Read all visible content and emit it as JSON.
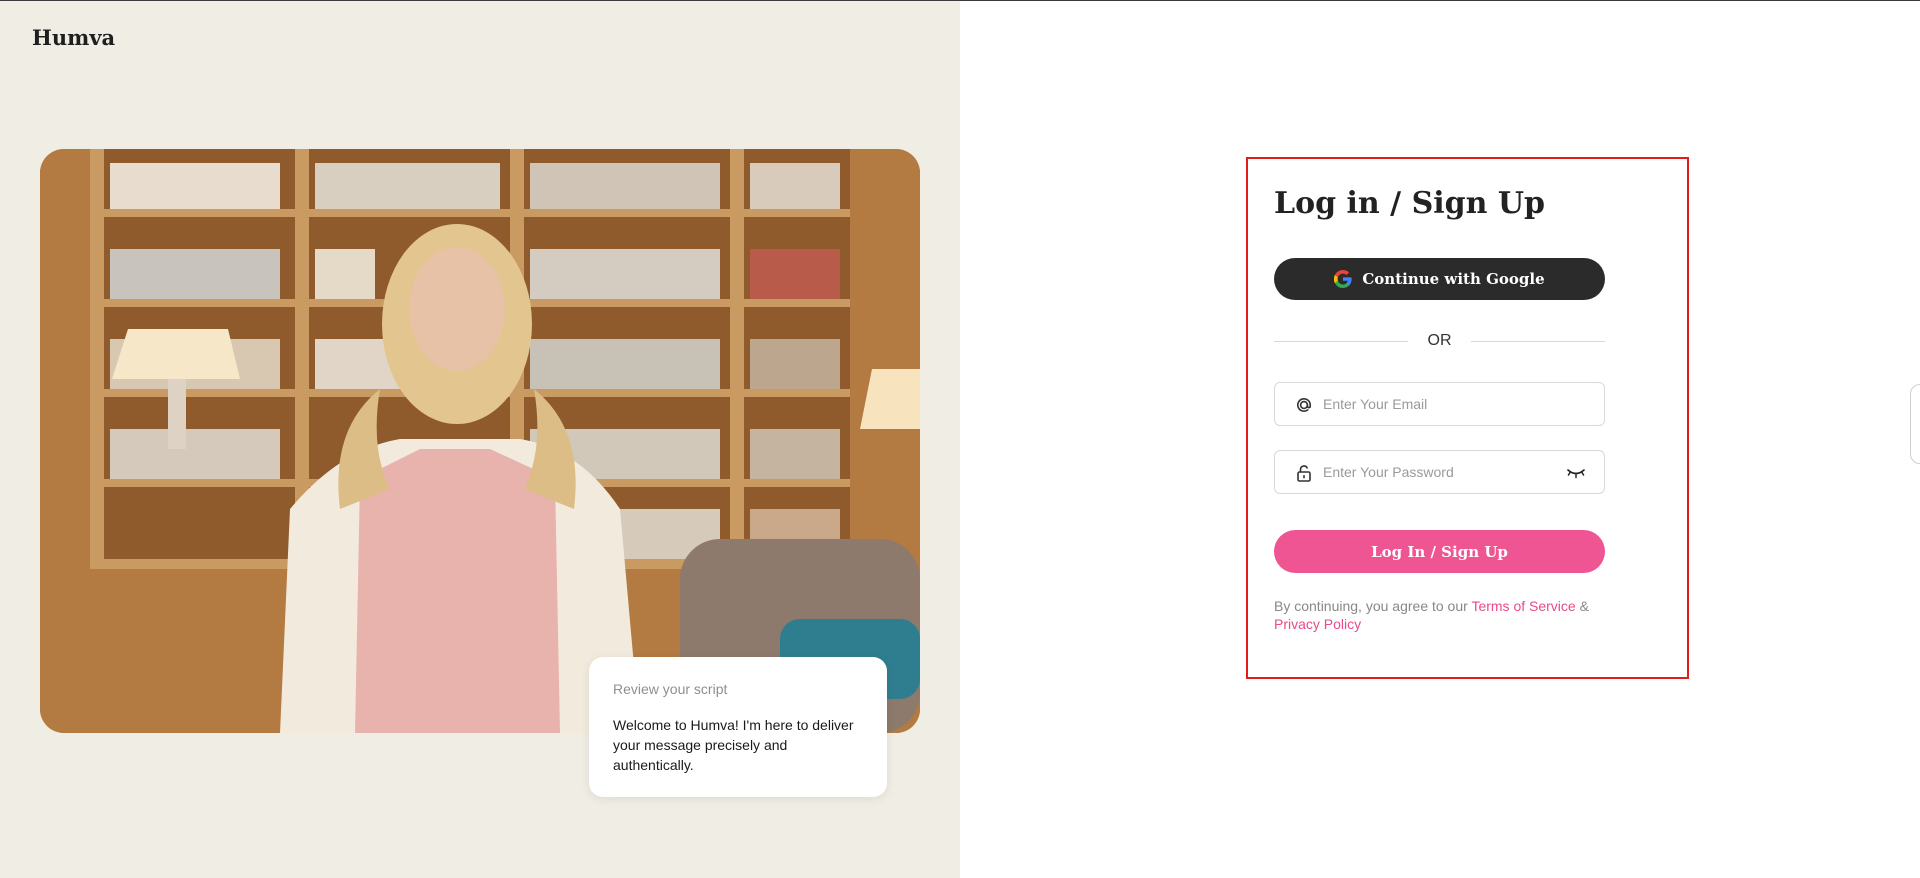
{
  "brand": {
    "name": "Humva"
  },
  "hero": {
    "script_card": {
      "title": "Review your script",
      "body": "Welcome to Humva! I'm here to deliver your message precisely and authentically."
    }
  },
  "auth": {
    "title": "Log in / Sign Up",
    "google_label": "Continue with Google",
    "divider": "OR",
    "email_placeholder": "Enter Your Email",
    "password_placeholder": "Enter Your Password",
    "submit_label": "Log In / Sign Up",
    "terms_prefix": "By continuing, you agree to our",
    "terms_link": "Terms of Service",
    "terms_and": "&",
    "privacy_link": "Privacy Policy"
  },
  "colors": {
    "accent": "#ef5592",
    "dark_button": "#2b2b2b",
    "highlight_border": "#e21b1b",
    "left_bg": "#efede4"
  },
  "icons": [
    "google-icon",
    "at-sign-icon",
    "lock-icon",
    "eye-closed-icon"
  ]
}
